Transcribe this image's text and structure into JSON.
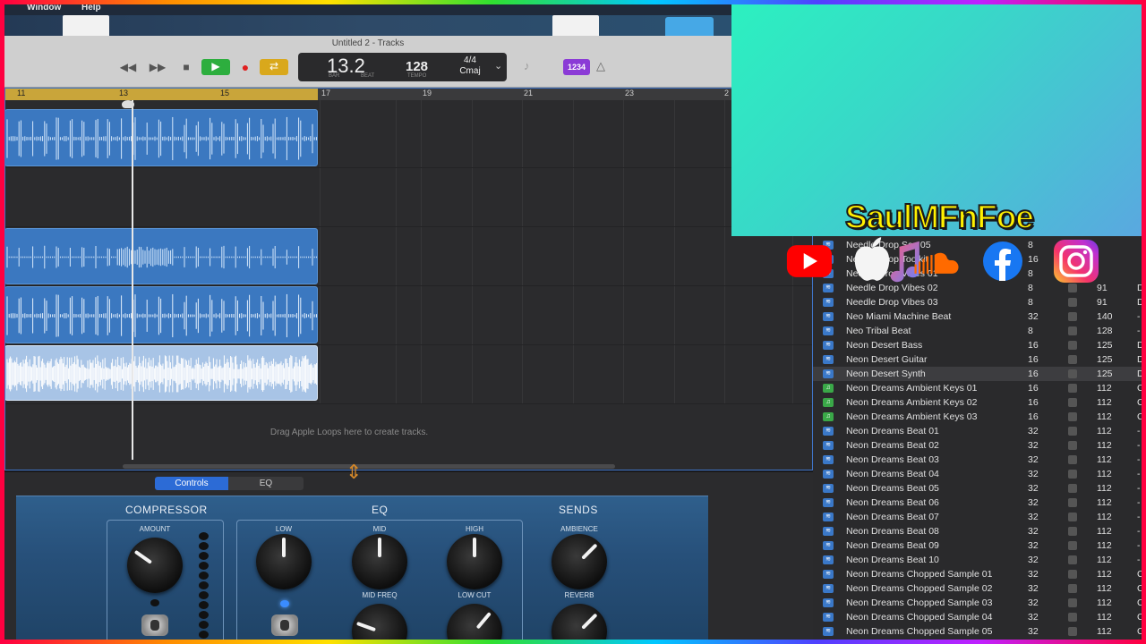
{
  "menubar": {
    "items": [
      "Window",
      "Help"
    ]
  },
  "window": {
    "title": "Untitled 2 - Tracks"
  },
  "transport": {
    "position": "13.2",
    "bar_label": "BAR",
    "beat_label": "BEAT",
    "tempo": "128",
    "tempo_label": "TEMPO",
    "time_signature": "4/4",
    "key": "Cmaj",
    "count_in": "1234"
  },
  "ruler": {
    "marks": [
      "11",
      "13",
      "15",
      "17",
      "19",
      "21",
      "23",
      "2"
    ]
  },
  "tracks": {
    "drag_hint": "Drag Apple Loops here to create tracks."
  },
  "smart_controls": {
    "tabs": [
      "Controls",
      "EQ"
    ],
    "compressor": {
      "title": "COMPRESSOR",
      "amount_label": "AMOUNT"
    },
    "eq": {
      "title": "EQ",
      "low_label": "LOW",
      "mid_label": "MID",
      "high_label": "HIGH",
      "mid_freq_label": "MID FREQ",
      "low_cut_label": "LOW CUT"
    },
    "sends": {
      "title": "SENDS",
      "ambience_label": "AMBIENCE",
      "reverb_label": "REVERB"
    }
  },
  "overlay": {
    "brand": "SaulMFnFoe",
    "accent_color": "#fff000"
  },
  "loops_browser": {
    "rows": [
      {
        "name": "Needle Drop Sax 05",
        "beats": "8",
        "tempo": "",
        "key": "",
        "icon": "waveform",
        "visible": "partial"
      },
      {
        "name": "Needle Drop Toolkit",
        "beats": "16",
        "tempo": "",
        "key": "",
        "icon": "waveform"
      },
      {
        "name": "Needle Drop Vibes 01",
        "beats": "8",
        "tempo": "",
        "key": "",
        "icon": "waveform"
      },
      {
        "name": "Needle Drop Vibes 02",
        "beats": "8",
        "tempo": "91",
        "key": "D",
        "icon": "waveform"
      },
      {
        "name": "Needle Drop Vibes 03",
        "beats": "8",
        "tempo": "91",
        "key": "D",
        "icon": "waveform"
      },
      {
        "name": "Neo Miami Machine Beat",
        "beats": "32",
        "tempo": "140",
        "key": "-",
        "icon": "waveform"
      },
      {
        "name": "Neo Tribal Beat",
        "beats": "8",
        "tempo": "128",
        "key": "-",
        "icon": "waveform"
      },
      {
        "name": "Neon Desert Bass",
        "beats": "16",
        "tempo": "125",
        "key": "D",
        "icon": "waveform"
      },
      {
        "name": "Neon Desert Guitar",
        "beats": "16",
        "tempo": "125",
        "key": "D",
        "icon": "waveform"
      },
      {
        "name": "Neon Desert Synth",
        "beats": "16",
        "tempo": "125",
        "key": "D",
        "icon": "waveform",
        "highlight": true
      },
      {
        "name": "Neon Dreams Ambient Keys 01",
        "beats": "16",
        "tempo": "112",
        "key": "C",
        "icon": "note"
      },
      {
        "name": "Neon Dreams Ambient Keys 02",
        "beats": "16",
        "tempo": "112",
        "key": "C",
        "icon": "note"
      },
      {
        "name": "Neon Dreams Ambient Keys 03",
        "beats": "16",
        "tempo": "112",
        "key": "C",
        "icon": "note"
      },
      {
        "name": "Neon Dreams Beat 01",
        "beats": "32",
        "tempo": "112",
        "key": "-",
        "icon": "waveform"
      },
      {
        "name": "Neon Dreams Beat 02",
        "beats": "32",
        "tempo": "112",
        "key": "-",
        "icon": "waveform"
      },
      {
        "name": "Neon Dreams Beat 03",
        "beats": "32",
        "tempo": "112",
        "key": "-",
        "icon": "waveform"
      },
      {
        "name": "Neon Dreams Beat 04",
        "beats": "32",
        "tempo": "112",
        "key": "-",
        "icon": "waveform"
      },
      {
        "name": "Neon Dreams Beat 05",
        "beats": "32",
        "tempo": "112",
        "key": "-",
        "icon": "waveform"
      },
      {
        "name": "Neon Dreams Beat 06",
        "beats": "32",
        "tempo": "112",
        "key": "-",
        "icon": "waveform"
      },
      {
        "name": "Neon Dreams Beat 07",
        "beats": "32",
        "tempo": "112",
        "key": "-",
        "icon": "waveform"
      },
      {
        "name": "Neon Dreams Beat 08",
        "beats": "32",
        "tempo": "112",
        "key": "-",
        "icon": "waveform"
      },
      {
        "name": "Neon Dreams Beat 09",
        "beats": "32",
        "tempo": "112",
        "key": "-",
        "icon": "waveform"
      },
      {
        "name": "Neon Dreams Beat 10",
        "beats": "32",
        "tempo": "112",
        "key": "-",
        "icon": "waveform"
      },
      {
        "name": "Neon Dreams Chopped Sample 01",
        "beats": "32",
        "tempo": "112",
        "key": "C",
        "icon": "waveform"
      },
      {
        "name": "Neon Dreams Chopped Sample 02",
        "beats": "32",
        "tempo": "112",
        "key": "C",
        "icon": "waveform"
      },
      {
        "name": "Neon Dreams Chopped Sample 03",
        "beats": "32",
        "tempo": "112",
        "key": "C",
        "icon": "waveform"
      },
      {
        "name": "Neon Dreams Chopped Sample 04",
        "beats": "32",
        "tempo": "112",
        "key": "C",
        "icon": "waveform"
      },
      {
        "name": "Neon Dreams Chopped Sample 05",
        "beats": "32",
        "tempo": "112",
        "key": "C",
        "icon": "waveform"
      }
    ]
  }
}
